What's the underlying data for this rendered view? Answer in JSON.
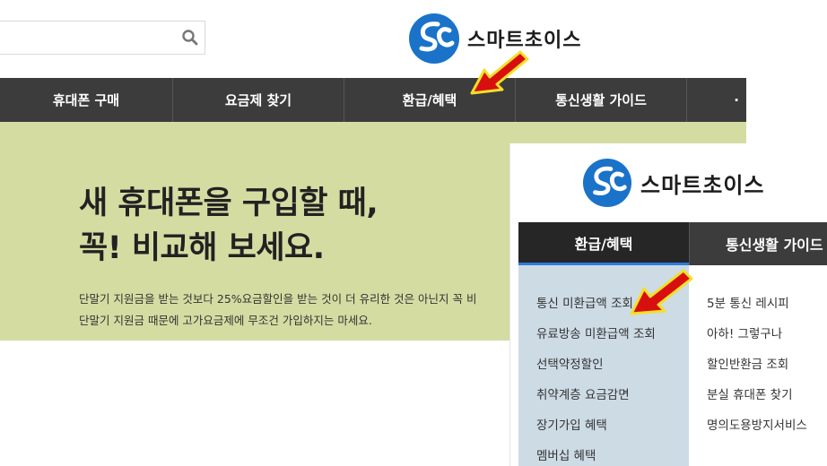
{
  "background_page": {
    "search": {
      "value": "",
      "placeholder": ""
    },
    "logo_text": "스마트초이스",
    "nav": [
      "휴대폰 구매",
      "요금제 찾기",
      "환급/혜택",
      "통신생활 가이드",
      "·"
    ],
    "hero": {
      "title_line1": "새 휴대폰을 구입할 때,",
      "title_line2": "꼭! 비교해 보세요.",
      "desc_line1": "단말기 지원금을 받는 것보다 25%요금할인을 받는 것이 더 유리한 것은 아닌지 꼭 비",
      "desc_line2": "단말기 지원금 때문에 고가요금제에 무조건 가입하지는 마세요."
    }
  },
  "zoomed_page": {
    "logo_text": "스마트초이스",
    "tabs": {
      "active": "환급/혜택",
      "next": "통신생활 가이드"
    },
    "menu_col1": [
      "통신 미환급액 조회",
      "유료방송 미환급액 조회",
      "선택약정할인",
      "취약계층 요금감면",
      "장기가입 혜택",
      "멤버십 혜택"
    ],
    "menu_col2": [
      "5분 통신 레시피",
      "아하! 그렇구나",
      "할인반환금 조회",
      "분실 휴대폰 찾기",
      "명의도용방지서비스"
    ]
  },
  "colors": {
    "nav_bg": "#3c3c3c",
    "nav_active_bg": "#262626",
    "active_underline": "#2b7ddb",
    "hero_bg": "#d5dca2",
    "dropdown_col1_bg": "#cddbe5",
    "logo_blue": "#1a73c9",
    "arrow_red": "#d80f0f",
    "arrow_outline": "#f2e02a"
  },
  "icons": {
    "search": "search-icon",
    "logo": "smartchoice-logo-icon",
    "pointer": "red-arrow-icon"
  }
}
